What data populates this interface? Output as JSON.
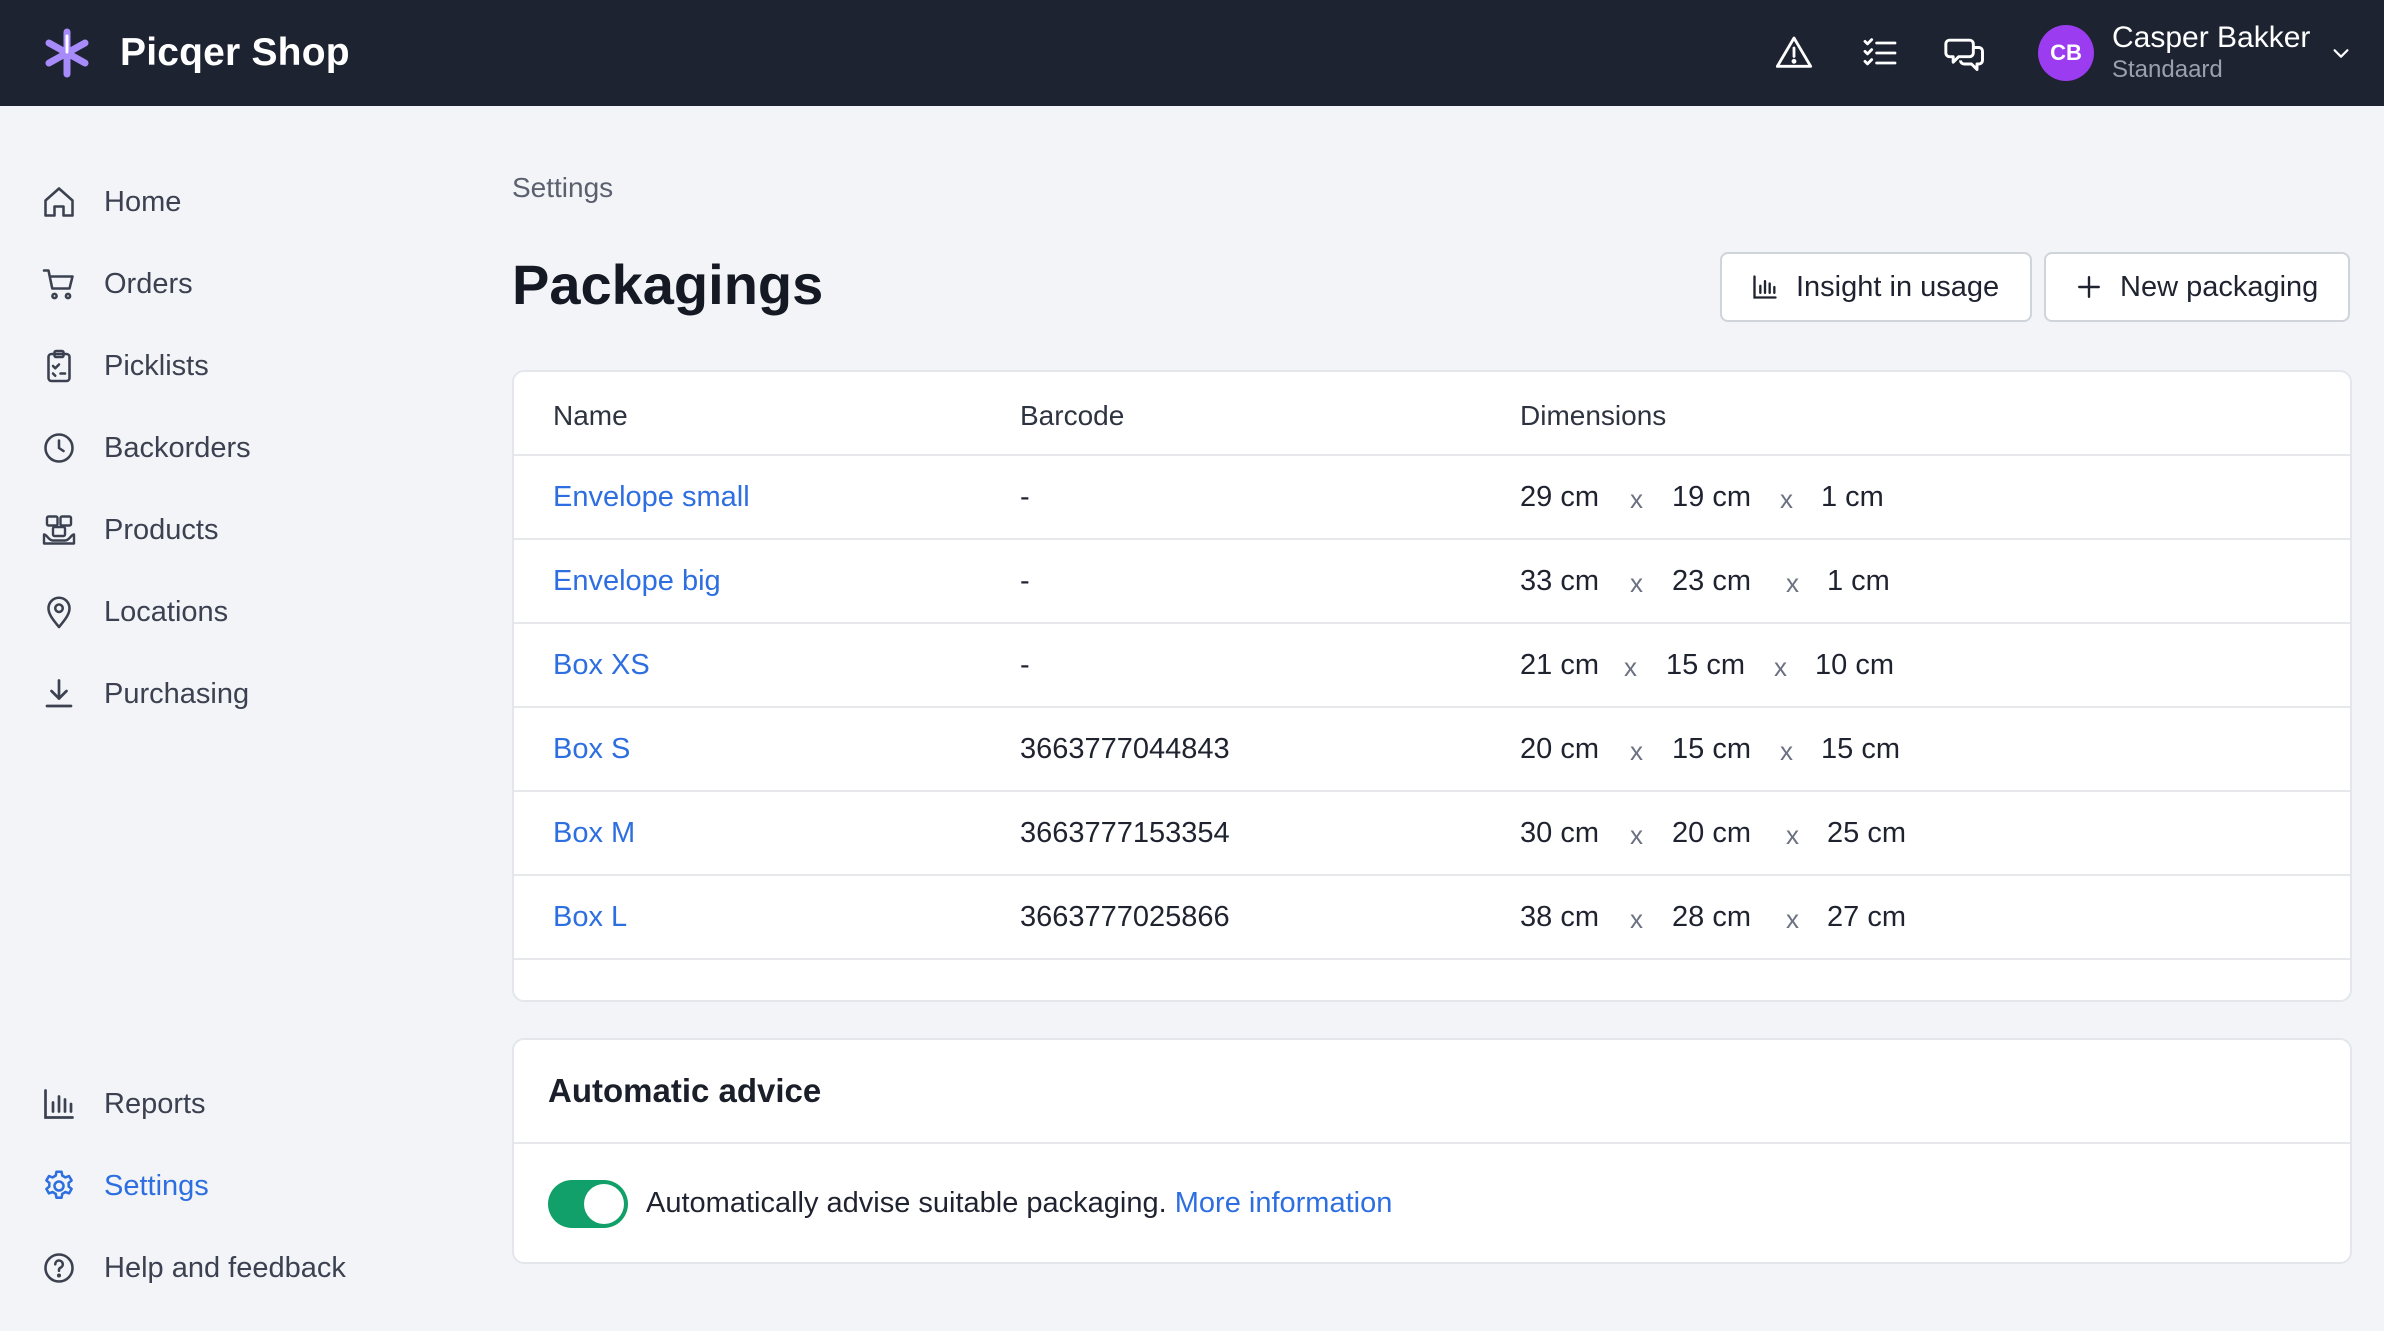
{
  "app": {
    "name": "Picqer Shop",
    "brand_color": "#8b5cf6"
  },
  "user": {
    "initials": "CB",
    "name": "Casper Bakker",
    "role": "Standaard",
    "avatar_color": "#9b3cf0"
  },
  "topbar": {
    "icons": [
      "warning-icon",
      "checklist-icon",
      "chat-icon"
    ]
  },
  "sidebar": {
    "items": [
      {
        "label": "Home",
        "icon": "home-icon"
      },
      {
        "label": "Orders",
        "icon": "cart-icon"
      },
      {
        "label": "Picklists",
        "icon": "clipboard-icon"
      },
      {
        "label": "Backorders",
        "icon": "clock-icon"
      },
      {
        "label": "Products",
        "icon": "products-icon"
      },
      {
        "label": "Locations",
        "icon": "location-pin-icon"
      },
      {
        "label": "Purchasing",
        "icon": "download-icon"
      }
    ],
    "bottom_items": [
      {
        "label": "Reports",
        "icon": "bar-chart-icon"
      },
      {
        "label": "Settings",
        "icon": "gear-icon",
        "active": true
      },
      {
        "label": "Help and feedback",
        "icon": "help-icon"
      }
    ]
  },
  "page": {
    "breadcrumb": "Settings",
    "title": "Packagings",
    "insight_button": "Insight in usage",
    "new_button": "New packaging"
  },
  "table": {
    "columns": [
      "Name",
      "Barcode",
      "Dimensions"
    ],
    "rows": [
      {
        "name": "Envelope small",
        "barcode": "-",
        "length": "29 cm",
        "width": "19 cm",
        "height": "1 cm"
      },
      {
        "name": "Envelope big",
        "barcode": "-",
        "length": "33 cm",
        "width": "23 cm",
        "height": "1 cm"
      },
      {
        "name": "Box XS",
        "barcode": "-",
        "length": "21 cm",
        "width": "15 cm",
        "height": "10 cm"
      },
      {
        "name": "Box S",
        "barcode": "3663777044843",
        "length": "20 cm",
        "width": "15 cm",
        "height": "15 cm"
      },
      {
        "name": "Box M",
        "barcode": "3663777153354",
        "length": "30 cm",
        "width": "20 cm",
        "height": "25 cm"
      },
      {
        "name": "Box L",
        "barcode": "3663777025866",
        "length": "38 cm",
        "width": "28 cm",
        "height": "27 cm"
      }
    ],
    "separator": "x"
  },
  "advice": {
    "title": "Automatic advice",
    "enabled": true,
    "text": "Automatically advise suitable packaging.",
    "link": "More information",
    "toggle_color": "#12a06a"
  },
  "colors": {
    "link": "#2d6fe0",
    "topbar": "#1d2331",
    "background": "#f3f4f7"
  }
}
